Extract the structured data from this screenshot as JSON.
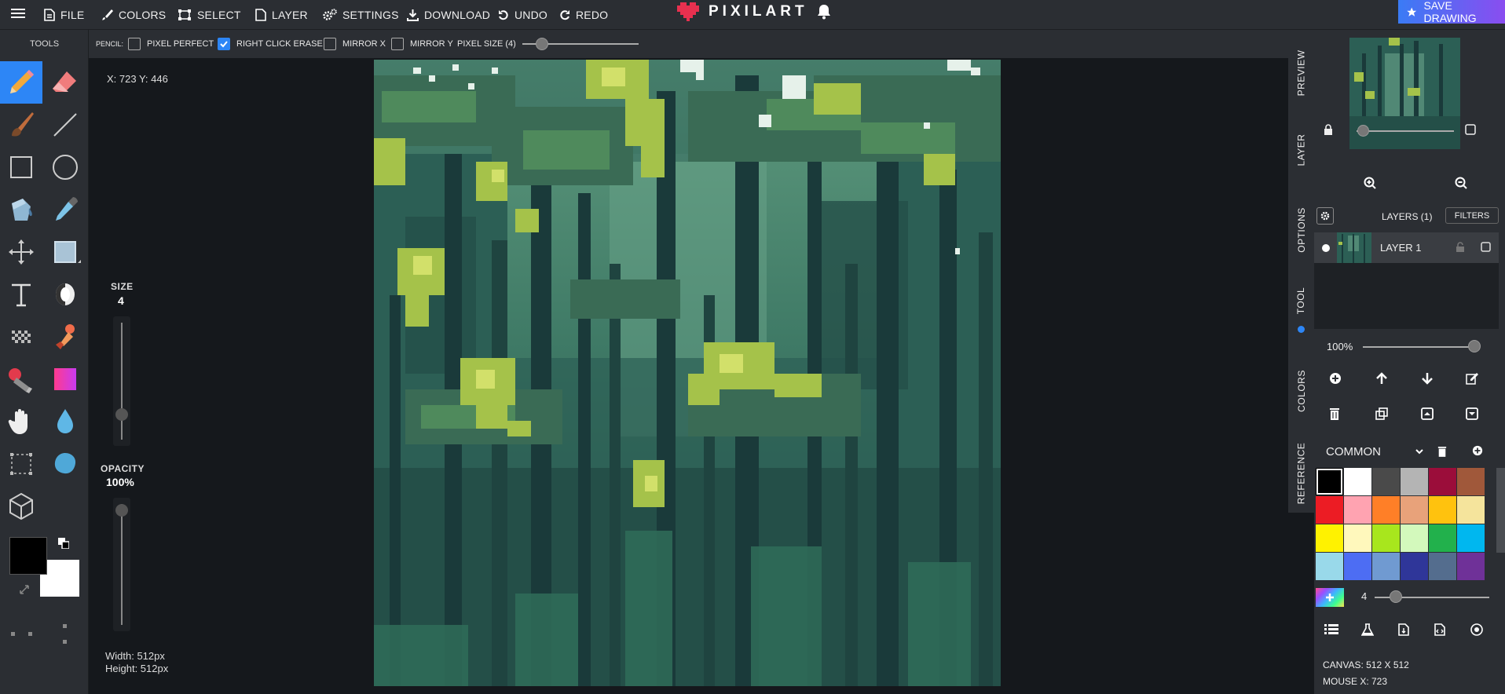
{
  "topbar": {
    "file": "FILE",
    "colors": "COLORS",
    "select": "SELECT",
    "layer": "LAYER",
    "settings": "SETTINGS",
    "download": "DOWNLOAD",
    "undo": "UNDO",
    "redo": "REDO",
    "logo": "PIXILART",
    "save": "SAVE DRAWING"
  },
  "tools": {
    "title": "TOOLS",
    "size_label": "SIZE",
    "size_value": "4",
    "size_level": 0.18,
    "opacity_label": "OPACITY",
    "opacity_value": "100%",
    "opacity_level": 1.0,
    "primary_color": "#000000",
    "secondary_color": "#ffffff"
  },
  "options": {
    "tool_name": "PENCIL:",
    "pixel_perfect": "PIXEL PERFECT",
    "pixel_perfect_checked": false,
    "right_click_erase": "RIGHT CLICK ERASE",
    "right_click_erase_checked": true,
    "mirror_x": "MIRROR X",
    "mirror_x_checked": false,
    "mirror_y": "MIRROR Y",
    "mirror_y_checked": false,
    "pixel_size": "PIXEL SIZE (4)"
  },
  "workspace": {
    "coords": "X: 723 Y: 446",
    "width": "Width: 512px",
    "height": "Height: 512px"
  },
  "right_tabs": [
    "PREVIEW",
    "LAYER",
    "OPTIONS",
    "TOOL",
    "COLORS",
    "REFERENCE"
  ],
  "layers": {
    "title": "LAYERS (1)",
    "filters": "FILTERS",
    "layer_name": "LAYER 1",
    "opacity": "100%"
  },
  "palette": {
    "name": "COMMON",
    "colors": [
      "#000000",
      "#ffffff",
      "#4a4a4a",
      "#b4b4b4",
      "#9b0d3a",
      "#a0583a",
      "#ec1c24",
      "#ffa3b1",
      "#ff7f27",
      "#e8a27a",
      "#ffc20e",
      "#f5e49c",
      "#fff200",
      "#fff8bc",
      "#a8e61d",
      "#d3f9bc",
      "#22b14c",
      "#00b7ef",
      "#99d9ea",
      "#4d6df3",
      "#709ad1",
      "#2f3699",
      "#546d8e",
      "#6f3198"
    ],
    "brush_value": "4"
  },
  "footer": {
    "canvas": "CANVAS: 512 X 512",
    "mouse": "MOUSE X: 723"
  }
}
